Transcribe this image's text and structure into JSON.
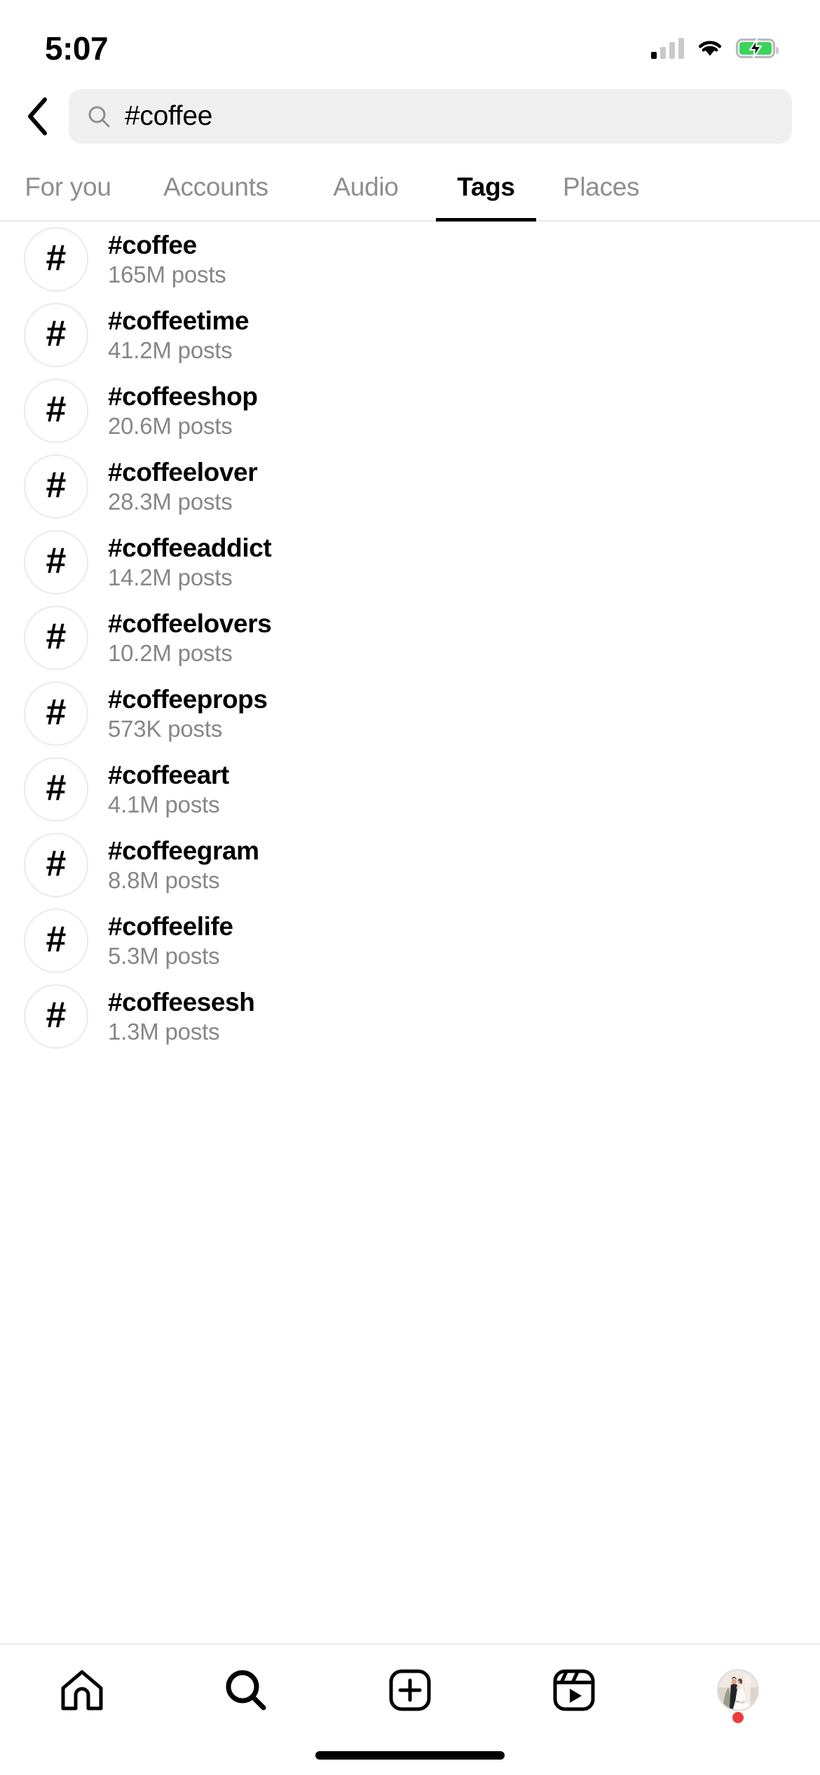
{
  "status_bar": {
    "time": "5:07",
    "signal_icon": "cellular-signal-icon",
    "wifi_icon": "wifi-icon",
    "battery_icon": "battery-charging-icon",
    "battery_color": "#3ad45c"
  },
  "header": {
    "back_icon": "back-chevron-icon",
    "search": {
      "icon": "search-icon",
      "value": "#coffee",
      "placeholder": "Search"
    }
  },
  "tabs": {
    "items": [
      {
        "label": "For you",
        "active": false
      },
      {
        "label": "Accounts",
        "active": false
      },
      {
        "label": "Audio",
        "active": false
      },
      {
        "label": "Tags",
        "active": true
      },
      {
        "label": "Places",
        "active": false
      }
    ],
    "active_color": "#000000",
    "inactive_color": "#8e8e8e"
  },
  "results": {
    "icon": "hashtag-icon",
    "items": [
      {
        "tag": "#coffee",
        "count": "165M posts"
      },
      {
        "tag": "#coffeetime",
        "count": "41.2M posts"
      },
      {
        "tag": "#coffeeshop",
        "count": "20.6M posts"
      },
      {
        "tag": "#coffeelover",
        "count": "28.3M posts"
      },
      {
        "tag": "#coffeeaddict",
        "count": "14.2M posts"
      },
      {
        "tag": "#coffeelovers",
        "count": "10.2M posts"
      },
      {
        "tag": "#coffeeprops",
        "count": "573K posts"
      },
      {
        "tag": "#coffeeart",
        "count": "4.1M posts"
      },
      {
        "tag": "#coffeegram",
        "count": "8.8M posts"
      },
      {
        "tag": "#coffeelife",
        "count": "5.3M posts"
      },
      {
        "tag": "#coffeesesh",
        "count": "1.3M posts"
      }
    ]
  },
  "bottom_nav": {
    "items": [
      {
        "name": "home-icon",
        "active": false
      },
      {
        "name": "search-icon",
        "active": true
      },
      {
        "name": "create-post-icon",
        "active": false
      },
      {
        "name": "reels-icon",
        "active": false
      },
      {
        "name": "profile-avatar",
        "active": false
      }
    ],
    "notification_dot_color": "#ed3b3b"
  },
  "home_indicator": "home-indicator-bar"
}
